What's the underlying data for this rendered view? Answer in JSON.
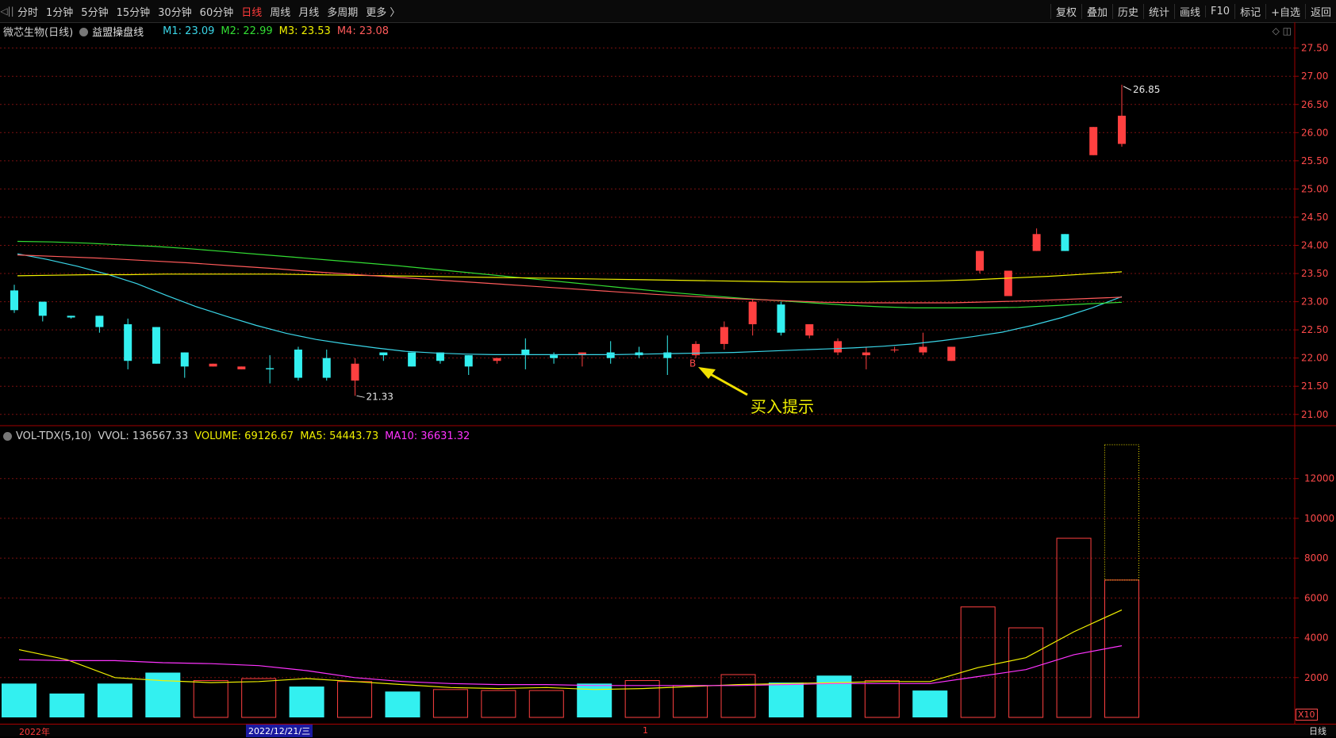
{
  "topbar": {
    "edge_label": "◁||",
    "periods": [
      "分时",
      "1分钟",
      "5分钟",
      "15分钟",
      "30分钟",
      "60分钟",
      "日线",
      "周线",
      "月线",
      "多周期",
      "更多 〉"
    ],
    "active_period": "日线",
    "tools": [
      "复权",
      "叠加",
      "历史",
      "统计",
      "画线",
      "F10",
      "标记",
      "+自选",
      "返回"
    ]
  },
  "price_panel": {
    "symbol": "微芯生物(日线)",
    "indicator": "益盟操盘线",
    "ma_labels": [
      {
        "text": "M1: 23.09",
        "color": "#3ad6e8"
      },
      {
        "text": "M2: 22.99",
        "color": "#33dd33"
      },
      {
        "text": "M3: 23.53",
        "color": "#f0f000"
      },
      {
        "text": "M4: 23.08",
        "color": "#ff5a5a"
      }
    ],
    "high_label": "26.85",
    "low_label": "21.33",
    "buy_marker": "B",
    "annotation": "买入提示"
  },
  "volume_panel": {
    "labels": [
      {
        "text": "VOL-TDX(5,10)",
        "color": "#d0d0d0"
      },
      {
        "text": "VVOL: 136567.33",
        "color": "#d0d0d0"
      },
      {
        "text": "VOLUME: 69126.67",
        "color": "#f0f000"
      },
      {
        "text": "MA5: 54443.73",
        "color": "#f0f000"
      },
      {
        "text": "MA10: 36631.32",
        "color": "#ff33ff"
      }
    ],
    "unit_label": "X10"
  },
  "bottom_bar": {
    "year": "2022年",
    "date": "2022/12/21/三",
    "tick": "1",
    "period": "日线"
  },
  "colors": {
    "up": "#ff4040",
    "down": "#33f0f0",
    "grid": "#7a1010",
    "axis_text": "#ff4a4a"
  },
  "chart_data": [
    {
      "type": "candlestick",
      "title": "微芯生物(日线)",
      "ylim": [
        20.8,
        27.65
      ],
      "yticks": [
        21.0,
        21.5,
        22.0,
        22.5,
        23.0,
        23.5,
        24.0,
        24.5,
        25.0,
        25.5,
        26.0,
        26.5,
        27.0,
        27.5
      ],
      "candles": [
        {
          "o": 23.2,
          "h": 23.3,
          "l": 22.8,
          "c": 22.85
        },
        {
          "o": 23.0,
          "h": 23.0,
          "l": 22.65,
          "c": 22.75
        },
        {
          "o": 22.75,
          "h": 22.75,
          "l": 22.7,
          "c": 22.72
        },
        {
          "o": 22.75,
          "h": 22.75,
          "l": 22.45,
          "c": 22.55
        },
        {
          "o": 22.6,
          "h": 22.7,
          "l": 21.8,
          "c": 21.95
        },
        {
          "o": 22.55,
          "h": 22.55,
          "l": 21.9,
          "c": 21.9
        },
        {
          "o": 22.1,
          "h": 22.1,
          "l": 21.65,
          "c": 21.85
        },
        {
          "o": 21.85,
          "h": 21.9,
          "l": 21.85,
          "c": 21.9
        },
        {
          "o": 21.8,
          "h": 21.85,
          "l": 21.8,
          "c": 21.85
        },
        {
          "o": 21.82,
          "h": 22.05,
          "l": 21.55,
          "c": 21.8
        },
        {
          "o": 22.15,
          "h": 22.2,
          "l": 21.6,
          "c": 21.65
        },
        {
          "o": 22.0,
          "h": 22.15,
          "l": 21.6,
          "c": 21.65
        },
        {
          "o": 21.6,
          "h": 22.0,
          "l": 21.33,
          "c": 21.9
        },
        {
          "o": 22.1,
          "h": 22.1,
          "l": 21.95,
          "c": 22.05
        },
        {
          "o": 22.1,
          "h": 22.1,
          "l": 21.85,
          "c": 21.85
        },
        {
          "o": 22.1,
          "h": 22.1,
          "l": 21.9,
          "c": 21.95
        },
        {
          "o": 22.05,
          "h": 22.05,
          "l": 21.7,
          "c": 21.85
        },
        {
          "o": 21.95,
          "h": 22.0,
          "l": 21.9,
          "c": 22.0
        },
        {
          "o": 22.15,
          "h": 22.35,
          "l": 21.8,
          "c": 22.05
        },
        {
          "o": 22.05,
          "h": 22.1,
          "l": 21.9,
          "c": 22.0
        },
        {
          "o": 22.05,
          "h": 22.1,
          "l": 21.85,
          "c": 22.1
        },
        {
          "o": 22.1,
          "h": 22.3,
          "l": 21.9,
          "c": 22.0
        },
        {
          "o": 22.1,
          "h": 22.2,
          "l": 22.0,
          "c": 22.05
        },
        {
          "o": 22.1,
          "h": 22.4,
          "l": 21.7,
          "c": 22.0
        },
        {
          "o": 22.05,
          "h": 22.3,
          "l": 22.0,
          "c": 22.25
        },
        {
          "o": 22.25,
          "h": 22.65,
          "l": 22.15,
          "c": 22.55
        },
        {
          "o": 22.6,
          "h": 23.05,
          "l": 22.4,
          "c": 23.0
        },
        {
          "o": 22.95,
          "h": 23.0,
          "l": 22.4,
          "c": 22.45
        },
        {
          "o": 22.4,
          "h": 22.6,
          "l": 22.35,
          "c": 22.6
        },
        {
          "o": 22.1,
          "h": 22.35,
          "l": 22.05,
          "c": 22.3
        },
        {
          "o": 22.05,
          "h": 22.2,
          "l": 21.8,
          "c": 22.1
        },
        {
          "o": 22.15,
          "h": 22.2,
          "l": 22.1,
          "c": 22.15
        },
        {
          "o": 22.1,
          "h": 22.45,
          "l": 22.05,
          "c": 22.2
        },
        {
          "o": 21.95,
          "h": 22.2,
          "l": 21.95,
          "c": 22.2
        },
        {
          "o": 23.55,
          "h": 23.9,
          "l": 23.5,
          "c": 23.9
        },
        {
          "o": 23.1,
          "h": 23.55,
          "l": 23.1,
          "c": 23.55
        },
        {
          "o": 23.9,
          "h": 24.3,
          "l": 23.9,
          "c": 24.2
        },
        {
          "o": 24.2,
          "h": 24.2,
          "l": 23.9,
          "c": 23.9
        },
        {
          "o": 25.6,
          "h": 26.1,
          "l": 25.6,
          "c": 26.1
        },
        {
          "o": 25.8,
          "h": 26.85,
          "l": 25.75,
          "c": 26.3
        }
      ],
      "ma_lines": {
        "M1": {
          "color": "#3ad6e8",
          "values": [
            23.85,
            23.75,
            23.63,
            23.49,
            23.32,
            23.11,
            22.91,
            22.74,
            22.58,
            22.44,
            22.33,
            22.25,
            22.18,
            22.12,
            22.09,
            22.07,
            22.06,
            22.06,
            22.06,
            22.06,
            22.06,
            22.07,
            22.08,
            22.09,
            22.1,
            22.12,
            22.14,
            22.16,
            22.18,
            22.21,
            22.25,
            22.31,
            22.38,
            22.46,
            22.58,
            22.72,
            22.89,
            23.09
          ]
        },
        "M2": {
          "color": "#33dd33",
          "values": [
            24.07,
            24.06,
            24.04,
            24.01,
            23.98,
            23.94,
            23.89,
            23.84,
            23.79,
            23.74,
            23.69,
            23.64,
            23.58,
            23.52,
            23.46,
            23.4,
            23.34,
            23.28,
            23.22,
            23.16,
            23.11,
            23.06,
            23.02,
            22.98,
            22.94,
            22.91,
            22.89,
            22.89,
            22.89,
            22.9,
            22.93,
            22.96,
            22.99
          ]
        },
        "M3": {
          "color": "#f0f000",
          "values": [
            23.46,
            23.47,
            23.48,
            23.48,
            23.49,
            23.49,
            23.49,
            23.49,
            23.48,
            23.47,
            23.46,
            23.45,
            23.44,
            23.43,
            23.42,
            23.41,
            23.4,
            23.39,
            23.38,
            23.37,
            23.36,
            23.35,
            23.35,
            23.35,
            23.36,
            23.37,
            23.39,
            23.42,
            23.45,
            23.49,
            23.53
          ]
        },
        "M4": {
          "color": "#ff5a5a",
          "values": [
            23.83,
            23.8,
            23.77,
            23.73,
            23.69,
            23.64,
            23.59,
            23.53,
            23.48,
            23.43,
            23.38,
            23.33,
            23.28,
            23.23,
            23.18,
            23.13,
            23.09,
            23.05,
            23.02,
            22.99,
            22.98,
            22.98,
            22.98,
            23.0,
            23.02,
            23.05,
            23.08
          ]
        }
      }
    },
    {
      "type": "bar",
      "title": "VOL-TDX(5,10)",
      "ylim": [
        0,
        13900
      ],
      "yticks": [
        2000,
        4000,
        6000,
        8000,
        10000,
        12000
      ],
      "values": [
        1700,
        1200,
        1700,
        2250,
        1850,
        1950,
        1550,
        1800,
        1300,
        1400,
        1350,
        1350,
        1700,
        1850,
        1600,
        2150,
        1750,
        2100,
        1850,
        1350,
        5550,
        4500,
        9000,
        6900
      ],
      "up": [
        false,
        false,
        false,
        false,
        true,
        true,
        false,
        true,
        false,
        true,
        true,
        true,
        false,
        true,
        true,
        true,
        false,
        false,
        true,
        false,
        true,
        true,
        true,
        true
      ],
      "last_high": 13700,
      "ma5": [
        3400,
        2900,
        2000,
        1850,
        1750,
        1800,
        1950,
        1800,
        1650,
        1500,
        1450,
        1500,
        1400,
        1450,
        1550,
        1650,
        1700,
        1750,
        1800,
        1800,
        2500,
        3000,
        4300,
        5400
      ],
      "ma10": [
        2900,
        2850,
        2850,
        2750,
        2700,
        2600,
        2350,
        2000,
        1800,
        1700,
        1650,
        1650,
        1600,
        1600,
        1600,
        1600,
        1650,
        1700,
        1700,
        1700,
        2050,
        2400,
        3150,
        3600
      ]
    }
  ]
}
